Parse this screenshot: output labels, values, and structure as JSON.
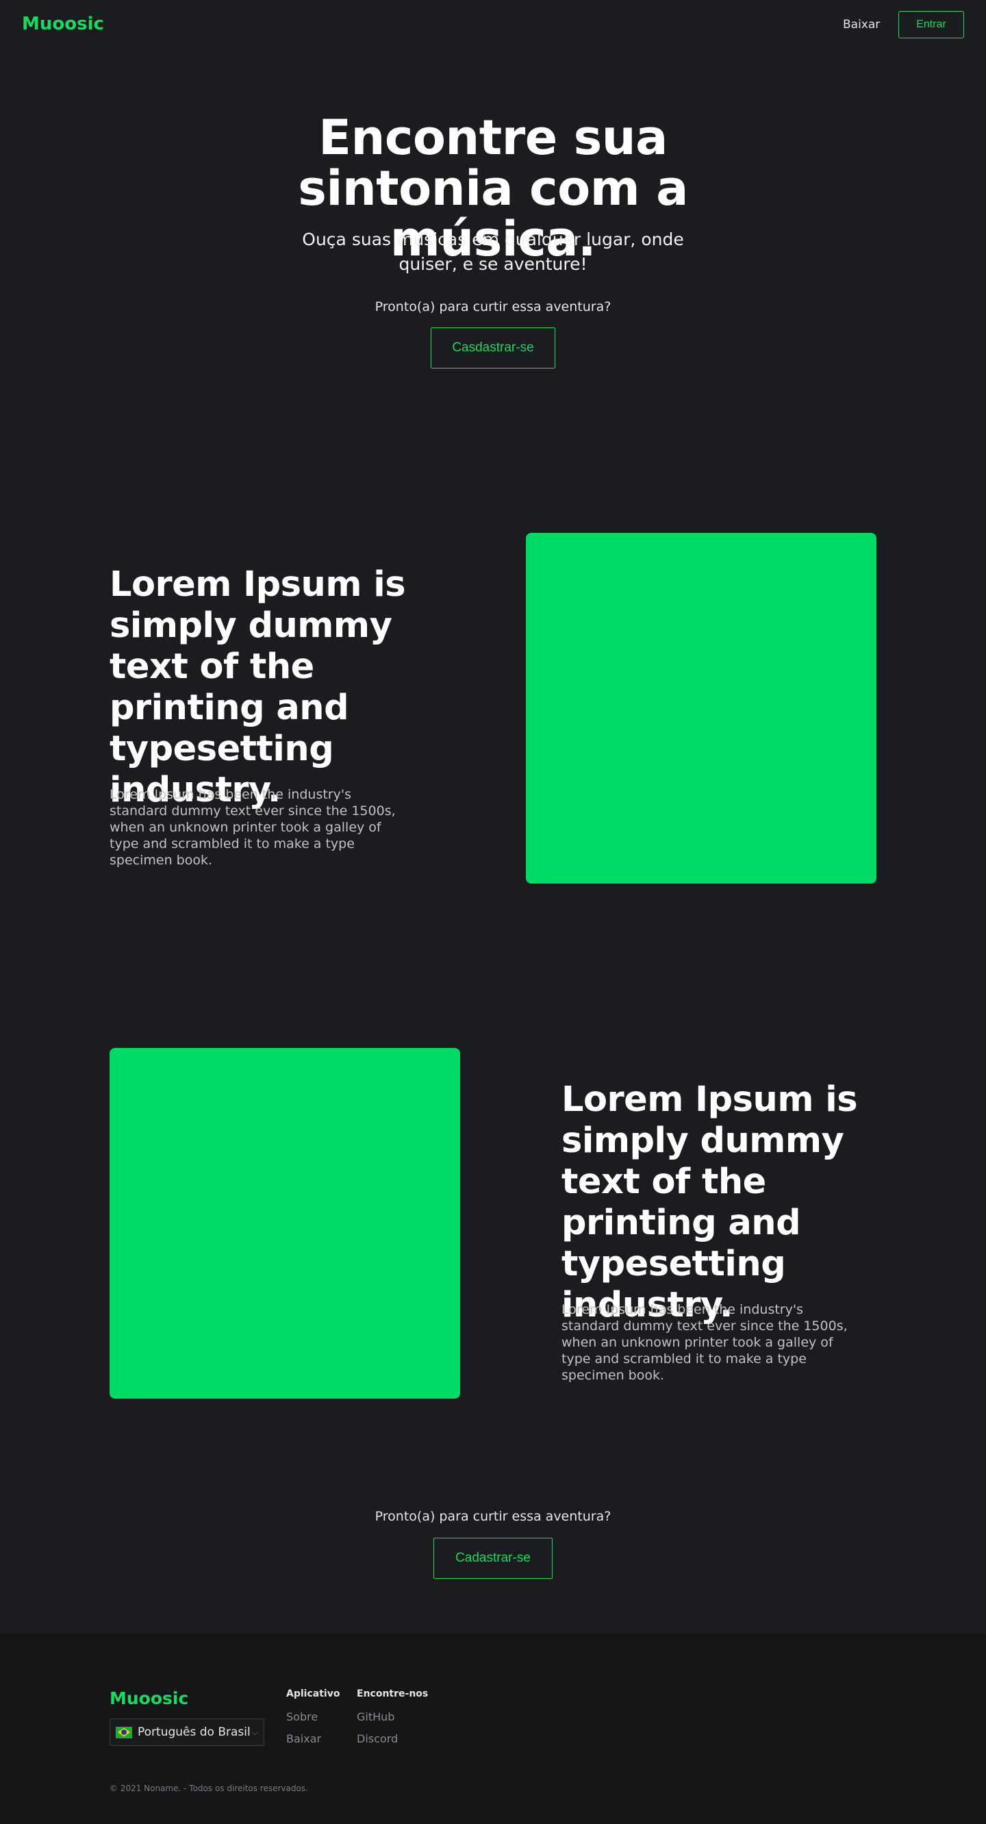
{
  "header": {
    "logo": "Muoosic",
    "download_link": "Baixar",
    "login_button": "Entrar"
  },
  "hero": {
    "title": "Encontre sua sintonia com a música.",
    "subtitle": "Ouça suas músicas em qualquer lugar, onde quiser, e se aventure!",
    "cta_text": "Pronto(a) para curtir essa aventura?",
    "signup_button": "Casdastrar-se"
  },
  "features": [
    {
      "title": "Lorem Ipsum is simply dummy text of the printing and typesetting industry.",
      "text": "Lorem Ipsum has been the industry's standard dummy text ever since the 1500s, when an unknown printer took a galley of type and scrambled it to make a type specimen book.",
      "image_color": "#00db66"
    },
    {
      "title": "Lorem Ipsum is simply dummy text of the printing and typesetting industry.",
      "text": "Lorem Ipsum has been the industry's standard dummy text ever since the 1500s, when an unknown printer took a galley of type and scrambled it to make a type specimen book.",
      "image_color": "#00db66"
    }
  ],
  "bottom_cta": {
    "text": "Pronto(a) para curtir essa aventura?",
    "signup_button": "Cadastrar-se"
  },
  "footer": {
    "logo": "Muoosic",
    "language": {
      "flag_icon": "brazil-flag-icon",
      "selected": "Português do Brasil"
    },
    "columns": [
      {
        "title": "Aplicativo",
        "links": [
          "Sobre",
          "Baixar"
        ]
      },
      {
        "title": "Encontre-nos",
        "links": [
          "GitHub",
          "Discord"
        ]
      }
    ],
    "copyright": "© 2021 Noname. - Todos os direitos reservados."
  },
  "colors": {
    "accent": "#1ed760",
    "background": "#1b1c1f",
    "footer_background": "#151618"
  }
}
